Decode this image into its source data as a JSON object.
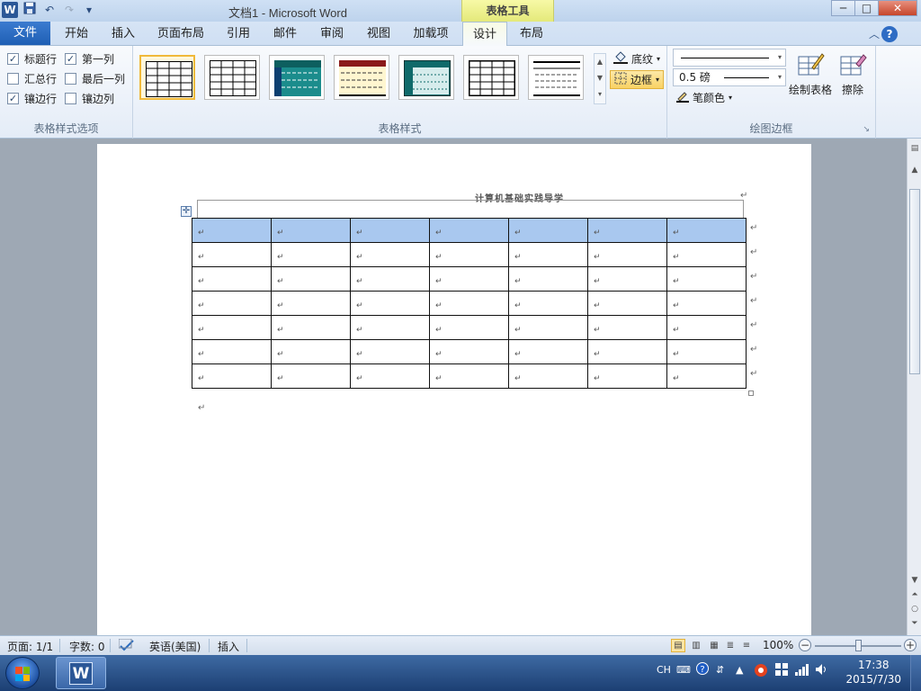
{
  "window": {
    "title": "文档1 - Microsoft Word",
    "contextual_tab_group": "表格工具",
    "qat": {
      "app_icon": "W",
      "undo_glyph": "↶",
      "redo_glyph": "↷",
      "more_glyph": "▾"
    },
    "controls": {
      "minimize": "─",
      "maximize": "□",
      "close": "✕"
    }
  },
  "tabs": [
    {
      "label": "文件"
    },
    {
      "label": "开始"
    },
    {
      "label": "插入"
    },
    {
      "label": "页面布局"
    },
    {
      "label": "引用"
    },
    {
      "label": "邮件"
    },
    {
      "label": "审阅"
    },
    {
      "label": "视图"
    },
    {
      "label": "加载项"
    },
    {
      "label": "设计"
    },
    {
      "label": "布局"
    }
  ],
  "ribbon": {
    "table_style_options": {
      "group_label": "表格样式选项",
      "options": [
        {
          "label": "标题行",
          "checked": true
        },
        {
          "label": "第一列",
          "checked": true
        },
        {
          "label": "汇总行",
          "checked": false
        },
        {
          "label": "最后一列",
          "checked": false
        },
        {
          "label": "镶边行",
          "checked": true
        },
        {
          "label": "镶边列",
          "checked": false
        }
      ]
    },
    "table_styles": {
      "group_label": "表格样式",
      "shading_label": "底纹",
      "borders_label": "边框"
    },
    "draw_borders": {
      "group_label": "绘图边框",
      "line_weight": "0.5 磅",
      "pen_color_label": "笔颜色",
      "draw_table_label": "绘制表格",
      "eraser_label": "擦除"
    }
  },
  "document": {
    "title_text": "计算机基础实践导学",
    "mark": "↵",
    "table": {
      "columns": 7,
      "rows": 7,
      "header_color": "#a9c8ef"
    }
  },
  "statusbar": {
    "page": "页面: 1/1",
    "words": "字数: 0",
    "language": "英语(美国)",
    "mode": "插入",
    "zoom": "100%",
    "zoom_level": 1.0
  },
  "taskbar": {
    "ime": "CH",
    "time": "17:38",
    "date": "2015/7/30"
  },
  "colors": {
    "accent": "#2b5797",
    "file_tab": "#1f5fb4",
    "context_tab": "#e4e97a"
  }
}
